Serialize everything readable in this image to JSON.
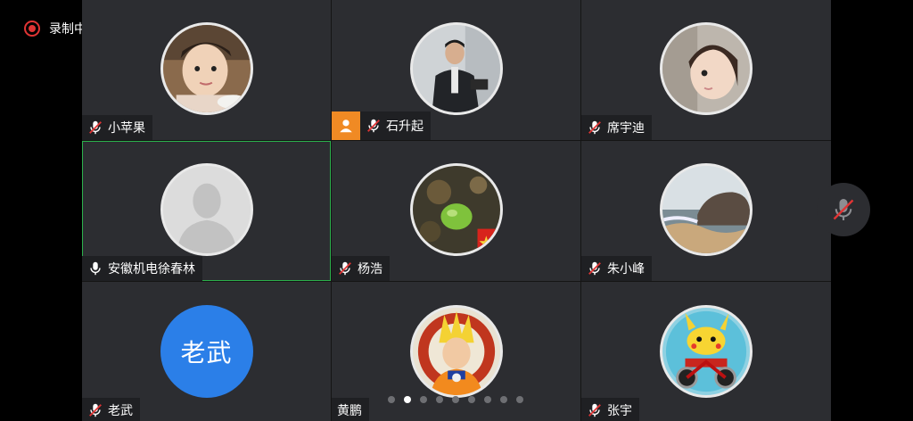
{
  "recording": {
    "label": "录制中",
    "color": "#e03434"
  },
  "participants": [
    {
      "name": "小苹果",
      "avatar": "photo-child",
      "mic": "muted"
    },
    {
      "name": "石升起",
      "avatar": "photo-man",
      "mic": "muted",
      "host": true
    },
    {
      "name": "席宇迪",
      "avatar": "photo-girl",
      "mic": "muted"
    },
    {
      "name": "安徽机电徐春林",
      "avatar": "default-person",
      "mic": "on",
      "active_speaker": true
    },
    {
      "name": "杨浩",
      "avatar": "photo-green-ball",
      "mic": "muted"
    },
    {
      "name": "朱小峰",
      "avatar": "photo-sea-rock",
      "mic": "muted"
    },
    {
      "name": "老武",
      "avatar": "text-initials",
      "avatar_text": "老武",
      "avatar_color": "#2b7fe8",
      "mic": "muted"
    },
    {
      "name": "黄鹏",
      "avatar": "photo-anime-hero",
      "mic": "none"
    },
    {
      "name": "张宇",
      "avatar": "photo-motorbike-cartoon",
      "mic": "muted"
    }
  ],
  "pagination": {
    "total": 9,
    "current": 2
  },
  "colors": {
    "tile_bg": "#2c2d31",
    "active_border": "#2bb04b",
    "host_badge": "#f08a24",
    "mute_red": "#e03434"
  },
  "floating_mic": {
    "state": "muted"
  }
}
